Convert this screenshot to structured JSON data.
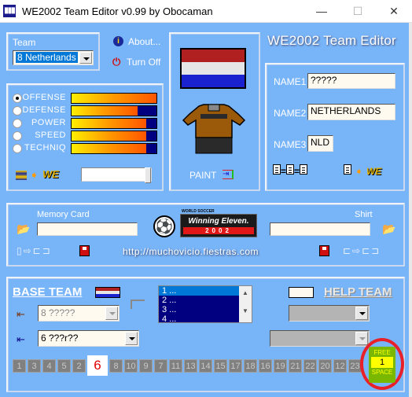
{
  "window": {
    "title": "WE2002 Team Editor v0.99 by Obocaman",
    "app_icon": "team-editor-icon",
    "controls": [
      "minimize",
      "maximize",
      "close"
    ],
    "minimize_glyph": "—",
    "maximize_glyph": "☐",
    "close_glyph": "✕"
  },
  "header": {
    "app_title": "WE2002 Team Editor",
    "about_label": "About...",
    "turnoff_label": "Turn Off"
  },
  "team": {
    "label": "Team",
    "selected": "8 Netherlands"
  },
  "stats": {
    "items": [
      {
        "label": "OFFENSE",
        "value": 1.0,
        "selected": true
      },
      {
        "label": "DEFENSE",
        "value": 0.78,
        "selected": false
      },
      {
        "label": "POWER",
        "value": 0.88,
        "selected": false
      },
      {
        "label": "SPEED",
        "value": 0.88,
        "selected": false
      },
      {
        "label": "TECHNIQ",
        "value": 0.88,
        "selected": false
      }
    ],
    "slider_value": 1.0
  },
  "kit": {
    "flag_colors": [
      "#b02020",
      "#e6e6e6",
      "#1a22d0"
    ],
    "shirt_color": "#9a5a0a",
    "shorts_color": "#2a2a2a",
    "paint_label": "PAINT"
  },
  "names": {
    "name1_label": "NAME1",
    "name1_value": "?????",
    "name2_label": "NAME2",
    "name2_value": "NETHERLANDS",
    "name3_label": "NAME3",
    "name3_value": "NLD"
  },
  "files": {
    "memory_card_label": "Memory Card",
    "memory_card_value": "",
    "shirt_label": "Shirt",
    "shirt_value": "",
    "logo_top": "WORLD SOCCER",
    "logo_main": "Winning Eleven.",
    "logo_year": "2002",
    "url": "http://muchovicio.fiestras.com"
  },
  "base_team": {
    "title": "BASE TEAM",
    "combo1_value": "8 ?????",
    "combo2_value": "6 ???r??",
    "list_items": [
      "1 ...",
      "2 ...",
      "3 ...",
      "4 ..."
    ],
    "list_selected_index": 0
  },
  "help_team": {
    "title": "HELP TEAM",
    "combo1_value": "",
    "combo2_value": ""
  },
  "slots": {
    "numbers": [
      "1",
      "3",
      "4",
      "5",
      "2",
      "6",
      "8",
      "10",
      "9",
      "7",
      "11",
      "13",
      "14",
      "15",
      "17",
      "18",
      "16",
      "19",
      "21",
      "22",
      "20",
      "12",
      "23"
    ],
    "highlighted": "6"
  },
  "free_space": {
    "top_label": "FREE",
    "value": "1",
    "bottom_label": "SPACE"
  },
  "colors": {
    "background": "#78b4f8",
    "accent_red": "#e8202a",
    "free_green": "#7ab800",
    "free_yellow": "#ffff00"
  }
}
